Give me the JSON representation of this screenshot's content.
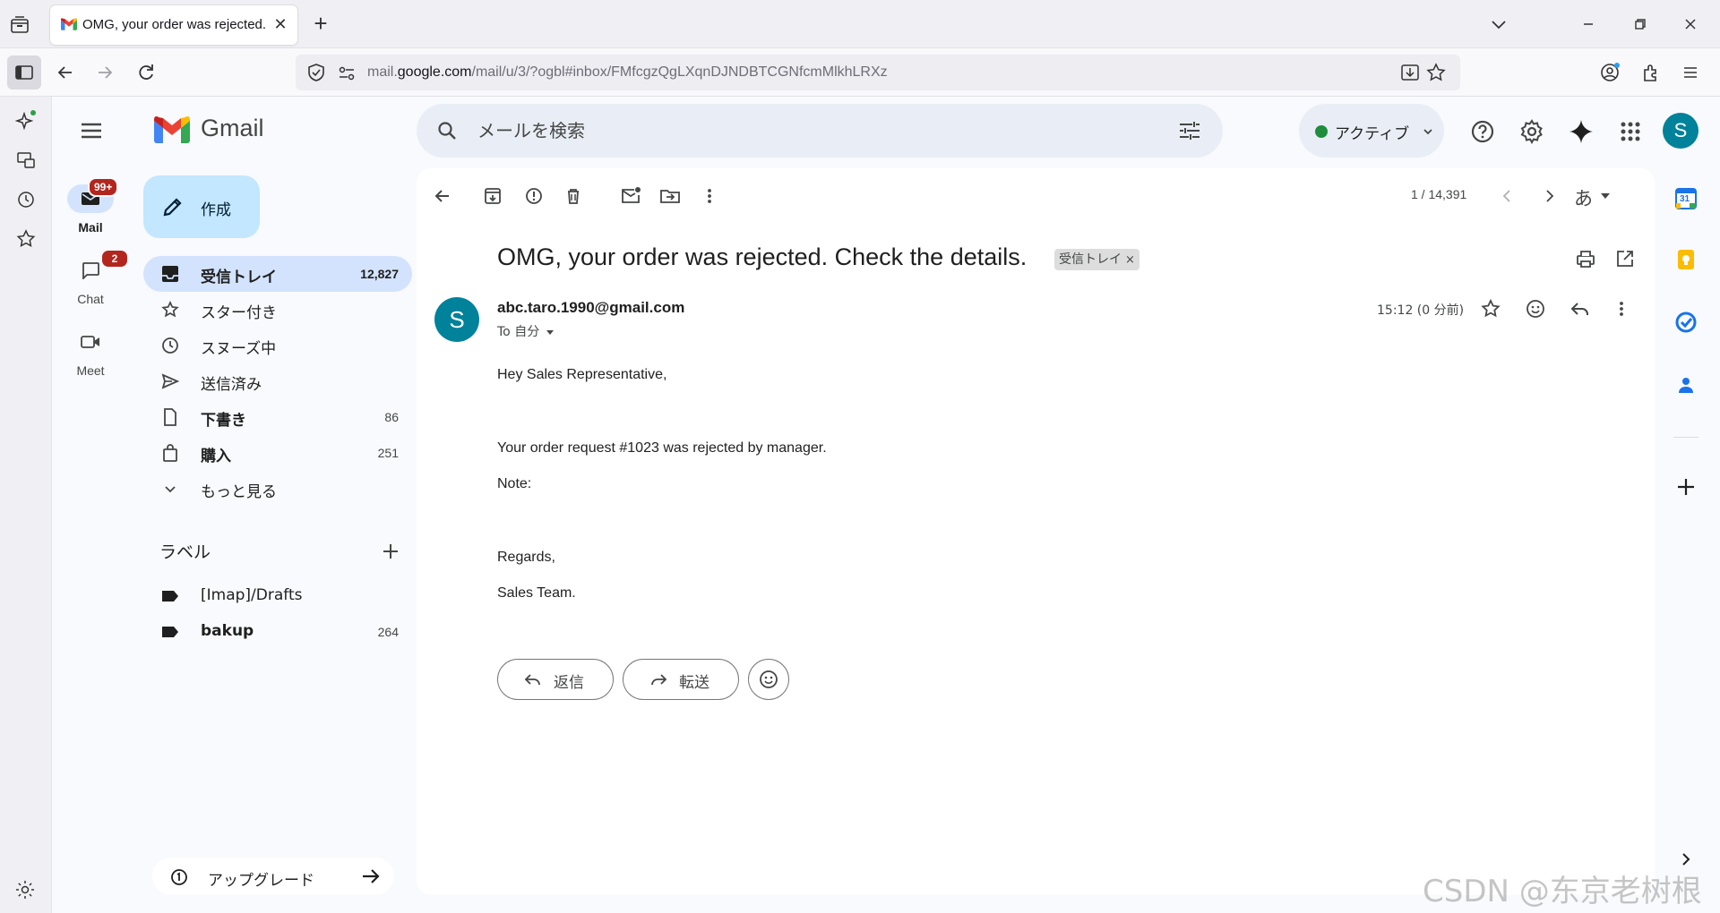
{
  "browser": {
    "tab_title": "OMG, your order was rejected. Che",
    "url_prefix": "mail.",
    "url_domain": "google.com",
    "url_path": "/mail/u/3/?ogbl#inbox/FMfcgzQgLXqnDJNDBTCGNfcmMlkhLRXz"
  },
  "rail": {
    "mail_label": "Mail",
    "mail_badge": "99+",
    "chat_label": "Chat",
    "chat_badge": "2",
    "meet_label": "Meet"
  },
  "header": {
    "app_name": "Gmail",
    "search_placeholder": "メールを検索",
    "status_label": "アクティブ",
    "avatar_letter": "S"
  },
  "sidebar": {
    "compose_label": "作成",
    "items": [
      {
        "label": "受信トレイ",
        "count": "12,827",
        "icon": "inbox-icon"
      },
      {
        "label": "スター付き",
        "count": "",
        "icon": "star-icon"
      },
      {
        "label": "スヌーズ中",
        "count": "",
        "icon": "clock-icon"
      },
      {
        "label": "送信済み",
        "count": "",
        "icon": "send-icon"
      },
      {
        "label": "下書き",
        "count": "86",
        "icon": "draft-icon"
      },
      {
        "label": "購入",
        "count": "251",
        "icon": "shopping-bag-icon"
      },
      {
        "label": "もっと見る",
        "count": "",
        "icon": "chevron-down-icon"
      }
    ],
    "labels_title": "ラベル",
    "labels": [
      {
        "label": "[Imap]/Drafts",
        "count": ""
      },
      {
        "label": "bakup",
        "count": "264"
      }
    ],
    "upgrade_label": "アップグレード"
  },
  "message": {
    "pager": "1 / 14,391",
    "input_tool": "あ",
    "subject": "OMG, your order was rejected. Check the details.",
    "chip_label": "受信トレイ",
    "chip_close": "×",
    "sender_initial": "S",
    "sender": "abc.taro.1990@gmail.com",
    "to": "To 自分",
    "time": "15:12 (0 分前)",
    "body": {
      "greeting": "Hey Sales Representative,",
      "line1": "Your order request #1023 was rejected by manager.",
      "note": "Note:",
      "regards": "Regards,",
      "signature": "Sales Team."
    },
    "reply_label": "返信",
    "forward_label": "転送"
  },
  "side_panel": {
    "calendar_day": "31"
  },
  "watermark": "CSDN @东京老树根",
  "colors": {
    "accent": "#0b57d0",
    "active_bg": "#d3e3fd",
    "compose_bg": "#c2e7ff",
    "badge_red": "#b3261e",
    "avatar": "#00829a",
    "status_green": "#1e8e3e"
  }
}
